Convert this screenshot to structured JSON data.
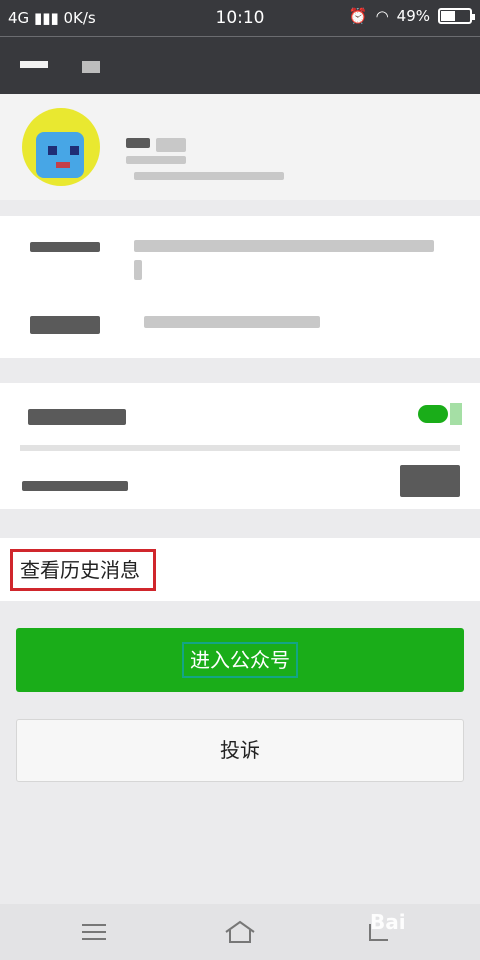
{
  "status_bar": {
    "network": "4G",
    "speed": "0K/s",
    "time": "10:10",
    "battery": "49%",
    "battery_level": 0.49
  },
  "nav": {
    "back_icon": "back-arrow-icon"
  },
  "history": {
    "label": "查看历史消息"
  },
  "actions": {
    "enter_label": "进入公众号",
    "complain_label": "投诉"
  },
  "watermark": {
    "text": "Bai"
  },
  "colors": {
    "primary": "#1aad19",
    "highlight": "#d0262c",
    "header": "#38393d"
  }
}
